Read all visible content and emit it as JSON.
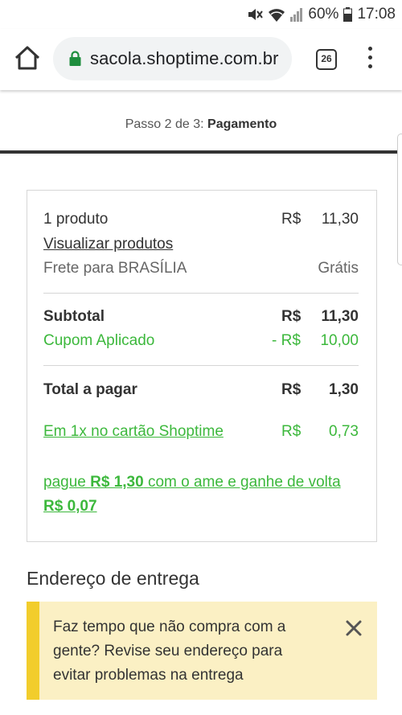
{
  "status_bar": {
    "battery": "60%",
    "time": "17:08"
  },
  "browser": {
    "url": "sacola.shoptime.com.br",
    "tab_count": "26"
  },
  "step": {
    "prefix": "Passo 2 de 3:",
    "current": "Pagamento"
  },
  "summary": {
    "products": {
      "label": "1 produto",
      "currency": "R$",
      "value": "11,30"
    },
    "view_products": "Visualizar produtos",
    "shipping": {
      "label": "Frete para BRASÍLIA",
      "value": "Grátis"
    },
    "subtotal": {
      "label": "Subtotal",
      "currency": "R$",
      "value": "11,30"
    },
    "coupon": {
      "label": "Cupom Aplicado",
      "currency": "- R$",
      "value": "10,00"
    },
    "total": {
      "label": "Total a pagar",
      "currency": "R$",
      "value": "1,30"
    },
    "installment": {
      "label": "Em 1x no cartão Shoptime",
      "currency": "R$",
      "value": "0,73"
    },
    "ame": {
      "pre": "pague ",
      "amount": "R$ 1,30",
      "mid": " com o ame e ganhe de volta ",
      "cashback": "R$ 0,07"
    }
  },
  "address": {
    "title": "Endereço de entrega",
    "notice": "Faz tempo que não compra com a gente? Revise seu endereço para evitar problemas na entrega"
  },
  "colors": {
    "accent_green": "#3cb83c",
    "notice_bg": "#fbf0c4",
    "notice_border": "#f2cd2c"
  },
  "icons": [
    "mute-icon",
    "wifi-icon",
    "signal-icon",
    "battery-icon",
    "home-icon",
    "lock-icon",
    "tabs-icon",
    "more-menu-icon",
    "close-icon"
  ]
}
